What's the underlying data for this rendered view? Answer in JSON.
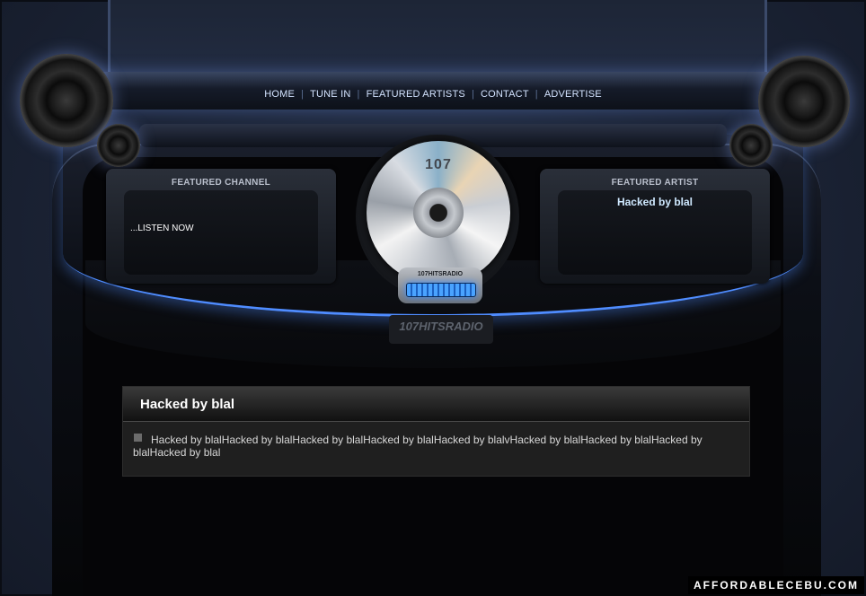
{
  "nav": {
    "items": [
      "HOME",
      "TUNE IN",
      "FEATURED ARTISTS",
      "CONTACT",
      "ADVERTISE"
    ],
    "separator": "|"
  },
  "featured_channel": {
    "title": "FEATURED CHANNEL",
    "listen_link": "...LISTEN NOW"
  },
  "featured_artist": {
    "title": "FEATURED ARTIST",
    "name": "Hacked by blal"
  },
  "player": {
    "disc_label": "107",
    "device_label": "107HITSRADIO",
    "brand": "107HITSRADIO"
  },
  "content": {
    "title": "Hacked by blal",
    "body": "Hacked by blalHacked by blalHacked by blalHacked by blalHacked by blalvHacked by blalHacked by blalHacked by blalHacked by blal"
  },
  "watermark": "AFFORDABLECEBU.COM",
  "colors": {
    "nav_text": "#d3e3ff",
    "accent_blue": "#4f8cff",
    "artist_text": "#cfe9ff"
  }
}
